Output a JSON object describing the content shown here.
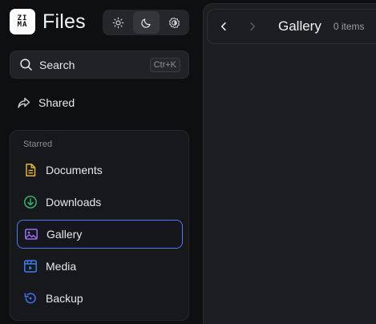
{
  "app": {
    "title": "Files",
    "logo_lines": [
      "ZI",
      "MA"
    ]
  },
  "theme_switch": {
    "options": [
      "sun-icon",
      "moon-icon",
      "auto-theme-icon"
    ],
    "active": "moon-icon"
  },
  "search": {
    "label": "Search",
    "shortcut": "Ctr+K"
  },
  "nav": {
    "shared_label": "Shared"
  },
  "starred": {
    "title": "Starred",
    "items": [
      {
        "label": "Documents",
        "icon": "document-icon",
        "color": "#e2b33b"
      },
      {
        "label": "Downloads",
        "icon": "download-icon",
        "color": "#34b36a"
      },
      {
        "label": "Gallery",
        "icon": "image-icon",
        "color": "#9a6cf2",
        "selected": true
      },
      {
        "label": "Media",
        "icon": "media-icon",
        "color": "#3d7cf0"
      },
      {
        "label": "Backup",
        "icon": "backup-icon",
        "color": "#3d6ff0"
      }
    ]
  },
  "main": {
    "title": "Gallery",
    "count": "0 items"
  },
  "colors": {
    "accent": "#4e7cf0",
    "background": "#0e0f11",
    "panel": "#1c1e21"
  }
}
